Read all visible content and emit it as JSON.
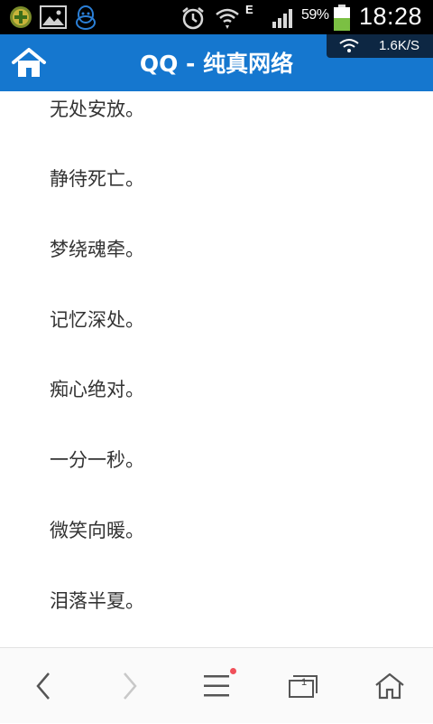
{
  "status_bar": {
    "left_icons": [
      "app-plus-icon",
      "gallery-icon",
      "qq-penguin-icon"
    ],
    "network_type": "E",
    "battery_percent": "59%",
    "time": "18:28",
    "net_speed": "1.6K/S",
    "icons": [
      "alarm-icon",
      "wifi-icon",
      "signal-icon",
      "battery-icon"
    ]
  },
  "header": {
    "title": "QQ - 纯真网络",
    "home_icon": "home-icon",
    "background_color": "#1577cf"
  },
  "content": {
    "lines": [
      "无处安放。",
      "静待死亡。",
      "梦绕魂牵。",
      "记忆深处。",
      "痴心绝对。",
      "一分一秒。",
      "微笑向暖。",
      "泪落半夏。"
    ]
  },
  "toolbar": {
    "buttons": [
      "back-icon",
      "forward-icon",
      "menu-icon",
      "tabs-icon",
      "home-icon"
    ],
    "tab_count": "1",
    "notification_dot_color": "#f0505a"
  }
}
